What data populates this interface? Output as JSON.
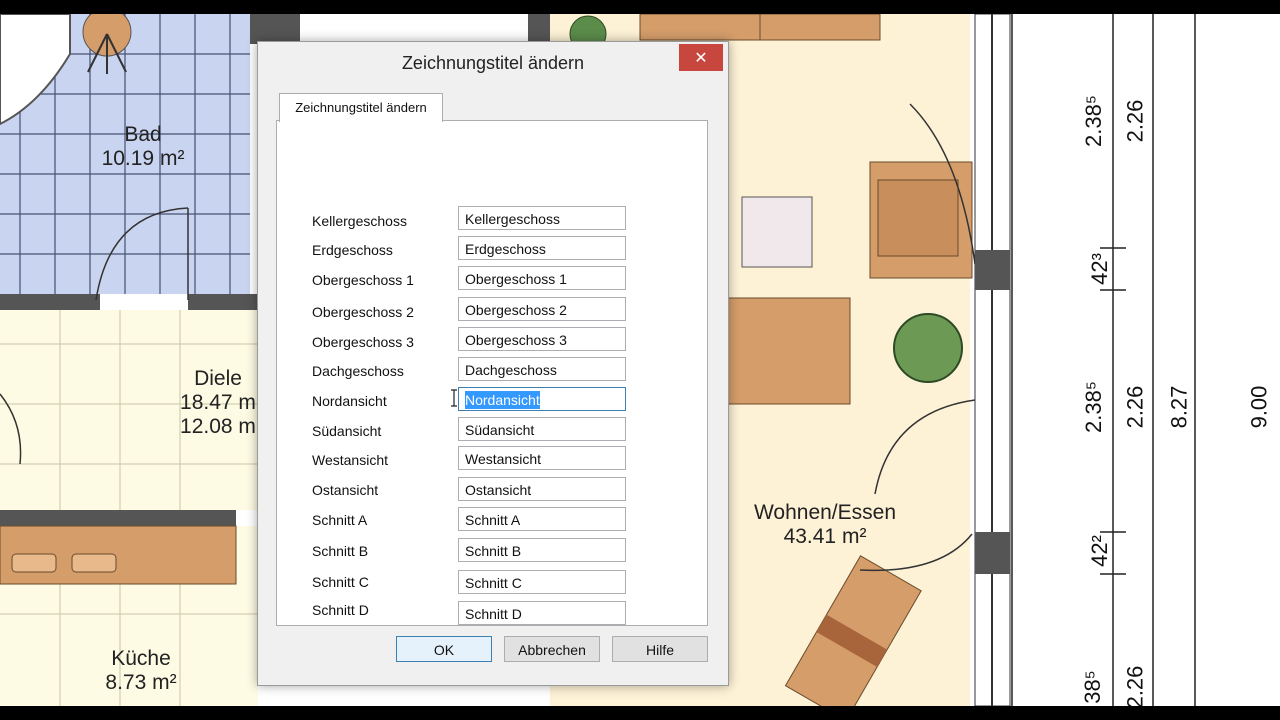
{
  "floorplan": {
    "rooms": [
      {
        "id": "bad",
        "name": "Bad",
        "area": "10.19 m²"
      },
      {
        "id": "diele",
        "name": "Diele",
        "area": "18.47 m",
        "area2": "12.08 m"
      },
      {
        "id": "kueche",
        "name": "Küche",
        "area": "8.73 m²"
      },
      {
        "id": "wohnen",
        "name": "Wohnen/Essen",
        "area": "43.41 m²"
      }
    ],
    "dimensions": [
      "2.38⁵",
      "2.26",
      "42³",
      "2.38⁵",
      "2.26",
      "8.27",
      "9.00",
      "42²",
      "38⁵",
      "2.26"
    ]
  },
  "dialog": {
    "title": "Zeichnungstitel ändern",
    "close_glyph": "✕",
    "tab_label": "Zeichnungstitel ändern",
    "rows": [
      {
        "label": "Kellergeschoss",
        "value": "Kellergeschoss"
      },
      {
        "label": "Erdgeschoss",
        "value": "Erdgeschoss"
      },
      {
        "label": "Obergeschoss 1",
        "value": "Obergeschoss 1"
      },
      {
        "label": "Obergeschoss 2",
        "value": "Obergeschoss 2"
      },
      {
        "label": "Obergeschoss 3",
        "value": "Obergeschoss 3"
      },
      {
        "label": "Dachgeschoss",
        "value": "Dachgeschoss"
      },
      {
        "label": "Nordansicht",
        "value": "Nordansicht"
      },
      {
        "label": "Südansicht",
        "value": "Südansicht"
      },
      {
        "label": "Westansicht",
        "value": "Westansicht"
      },
      {
        "label": "Ostansicht",
        "value": "Ostansicht"
      },
      {
        "label": "Schnitt A",
        "value": "Schnitt A"
      },
      {
        "label": "Schnitt B",
        "value": "Schnitt B"
      },
      {
        "label": "Schnitt C",
        "value": "Schnitt C"
      },
      {
        "label": "Schnitt D",
        "value": "Schnitt D"
      }
    ],
    "buttons": {
      "ok": "OK",
      "cancel": "Abbrechen",
      "help": "Hilfe"
    }
  },
  "colors": {
    "bath": "#c9d4f0",
    "hall": "#fdfbe3",
    "living": "#fdf1d6",
    "wood": "#d49d6a",
    "accent": "#3399ff",
    "close": "#c7463d"
  }
}
